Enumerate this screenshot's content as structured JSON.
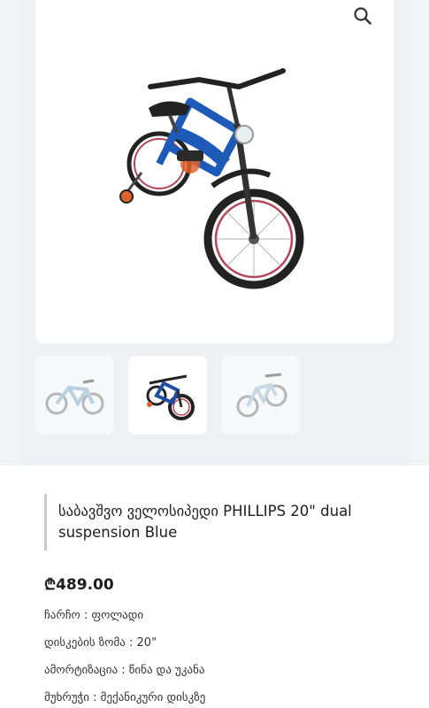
{
  "product": {
    "title": "საბავშვო ველოსიპედი PHILLIPS 20\" dual suspension Blue",
    "price": "₾489.00",
    "specs": [
      "ჩარჩო : ფოლადი",
      "დისკების ზომა : 20\"",
      "ამორტიზაცია : წინა და უკანა",
      "მუხრუჭი : მექანიკური დისკზე"
    ]
  },
  "gallery": {
    "thumbnails": [
      {
        "name": "light-blue-bike",
        "color": "#8eb7d6"
      },
      {
        "name": "dark-blue-bike",
        "color": "#1f4fa3"
      },
      {
        "name": "silver-blue-bike",
        "color": "#a9c3d6"
      }
    ]
  },
  "colors": {
    "bike_frame": "#1e5bb8",
    "tire": "#222222",
    "rim_accent": "#b5455a",
    "accent_orange": "#e0602a"
  },
  "icons": {
    "zoom": "magnifier-icon"
  }
}
